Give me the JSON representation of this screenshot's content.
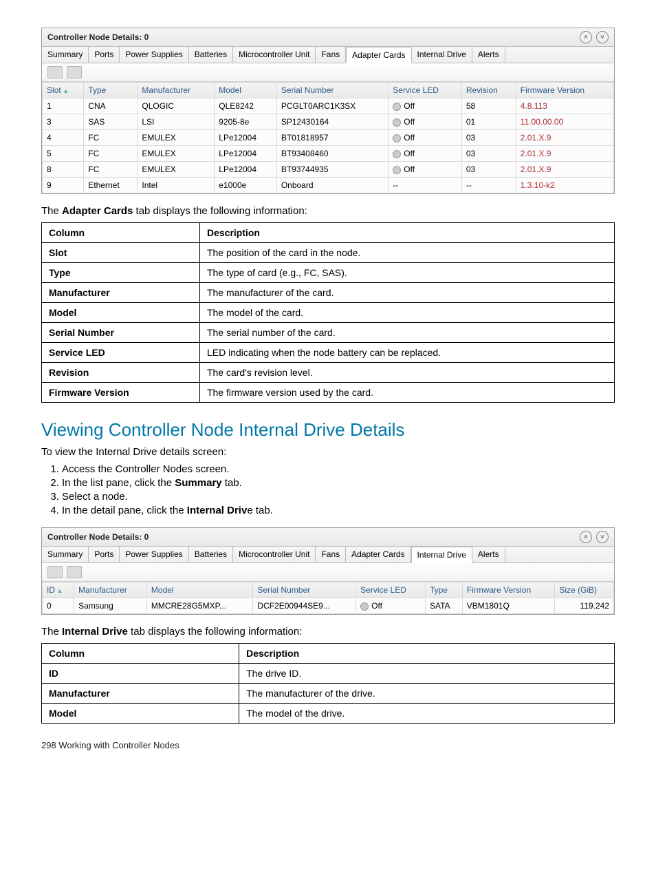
{
  "panel1": {
    "title": "Controller Node Details: 0",
    "tabs": [
      "Summary",
      "Ports",
      "Power Supplies",
      "Batteries",
      "Microcontroller Unit",
      "Fans",
      "Adapter Cards",
      "Internal Drive",
      "Alerts"
    ],
    "activeTab": 6,
    "columns": [
      "Slot",
      "Type",
      "Manufacturer",
      "Model",
      "Serial Number",
      "Service LED",
      "Revision",
      "Firmware Version"
    ],
    "rows": [
      {
        "slot": "1",
        "type": "CNA",
        "mfr": "QLOGIC",
        "model": "QLE8242",
        "serial": "PCGLT0ARC1K3SX",
        "led": "Off",
        "rev": "58",
        "fw": "4.8.113"
      },
      {
        "slot": "3",
        "type": "SAS",
        "mfr": "LSI",
        "model": "9205-8e",
        "serial": "SP12430164",
        "led": "Off",
        "rev": "01",
        "fw": "11.00.00.00"
      },
      {
        "slot": "4",
        "type": "FC",
        "mfr": "EMULEX",
        "model": "LPe12004",
        "serial": "BT01818957",
        "led": "Off",
        "rev": "03",
        "fw": "2.01.X.9"
      },
      {
        "slot": "5",
        "type": "FC",
        "mfr": "EMULEX",
        "model": "LPe12004",
        "serial": "BT93408460",
        "led": "Off",
        "rev": "03",
        "fw": "2.01.X.9"
      },
      {
        "slot": "8",
        "type": "FC",
        "mfr": "EMULEX",
        "model": "LPe12004",
        "serial": "BT93744935",
        "led": "Off",
        "rev": "03",
        "fw": "2.01.X.9"
      },
      {
        "slot": "9",
        "type": "Ethernet",
        "mfr": "Intel",
        "model": "e1000e",
        "serial": "Onboard",
        "led": "--",
        "rev": "--",
        "fw": "1.3.10-k2"
      }
    ]
  },
  "body1_intro": "The ",
  "body1_strong": "Adapter Cards",
  "body1_rest": "  tab displays the following information:",
  "docTable1": {
    "headers": [
      "Column",
      "Description"
    ],
    "rows": [
      [
        "Slot",
        "The position of the card in the node."
      ],
      [
        "Type",
        "The type of card (e.g., FC, SAS)."
      ],
      [
        "Manufacturer",
        "The manufacturer of the card."
      ],
      [
        "Model",
        "The model of the card."
      ],
      [
        "Serial Number",
        "The serial number of the card."
      ],
      [
        "Service LED",
        "LED indicating when the node battery can be replaced."
      ],
      [
        "Revision",
        "The card's revision level."
      ],
      [
        "Firmware Version",
        "The firmware version used by the card."
      ]
    ]
  },
  "sectionTitle": "Viewing Controller Node Internal Drive Details",
  "sectionIntro": "To view the Internal Drive details screen:",
  "steps": [
    {
      "text": "Access the Controller Nodes screen."
    },
    {
      "pre": "In the list pane, click the ",
      "bold": "Summary",
      "post": " tab."
    },
    {
      "text": "Select a node."
    },
    {
      "pre": "In the detail pane, click the ",
      "bold": "Internal Driv",
      "post": "e tab."
    }
  ],
  "panel2": {
    "title": "Controller Node Details: 0",
    "tabs": [
      "Summary",
      "Ports",
      "Power Supplies",
      "Batteries",
      "Microcontroller Unit",
      "Fans",
      "Adapter Cards",
      "Internal Drive",
      "Alerts"
    ],
    "activeTab": 7,
    "columns": [
      "ID",
      "Manufacturer",
      "Model",
      "Serial Number",
      "Service LED",
      "Type",
      "Firmware Version",
      "Size (GiB)"
    ],
    "rows": [
      {
        "id": "0",
        "mfr": "Samsung",
        "model": "MMCRE28G5MXP...",
        "serial": "DCF2E00944SE9...",
        "led": "Off",
        "type": "SATA",
        "fw": "VBM1801Q",
        "size": "119.242"
      }
    ]
  },
  "body2_intro": "The ",
  "body2_strong": "Internal Drive",
  "body2_rest": "  tab displays the following information:",
  "docTable2": {
    "headers": [
      "Column",
      "Description"
    ],
    "rows": [
      [
        "ID",
        "The drive ID."
      ],
      [
        "Manufacturer",
        "The manufacturer of the drive."
      ],
      [
        "Model",
        "The model of the drive."
      ]
    ]
  },
  "footer": "298   Working with Controller Nodes"
}
